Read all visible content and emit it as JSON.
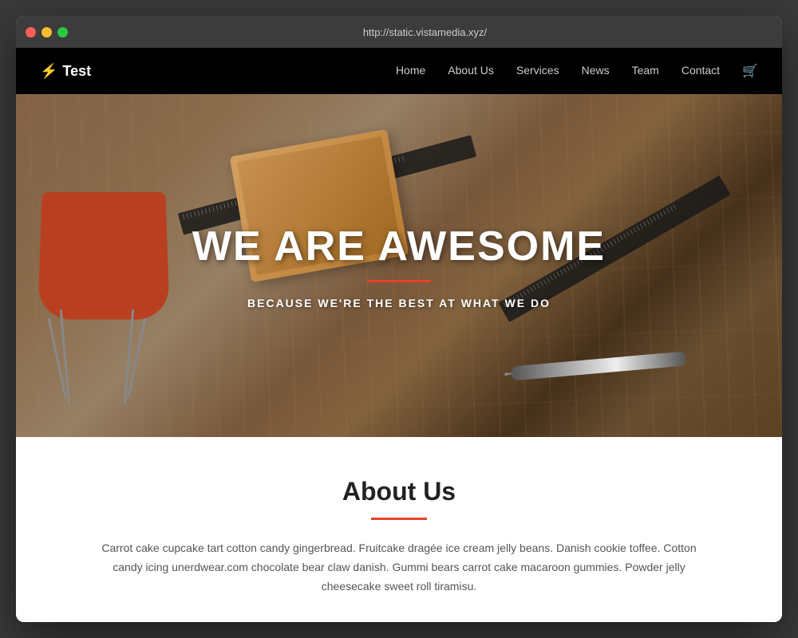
{
  "browser": {
    "url": "http://static.vistamedia.xyz/"
  },
  "navbar": {
    "brand_icon": "⚡",
    "brand_name": "Test",
    "links": [
      {
        "label": "Home",
        "href": "#"
      },
      {
        "label": "About Us",
        "href": "#"
      },
      {
        "label": "Services",
        "href": "#"
      },
      {
        "label": "News",
        "href": "#"
      },
      {
        "label": "Team",
        "href": "#"
      },
      {
        "label": "Contact",
        "href": "#"
      }
    ]
  },
  "hero": {
    "title": "WE ARE AWESOME",
    "subtitle": "BECAUSE WE'RE THE BEST AT WHAT WE DO"
  },
  "about": {
    "title": "About Us",
    "body": "Carrot cake cupcake tart cotton candy gingerbread. Fruitcake dragée ice cream jelly beans. Danish cookie toffee. Cotton candy icing unerdwear.com chocolate bear claw danish. Gummi bears carrot cake macaroon gummies. Powder jelly cheesecake sweet roll tiramisu."
  }
}
